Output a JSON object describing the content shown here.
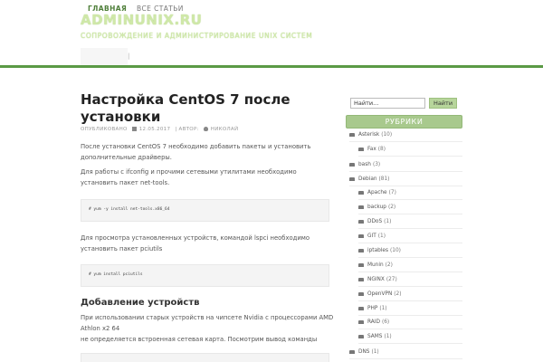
{
  "site": {
    "title": "ADMINUNIX.RU",
    "tagline": "СОПРОВОЖДЕНИЕ И АДМИНИСТРИРОВАНИЕ UNIX СИСТЕМ"
  },
  "nav": {
    "items": [
      {
        "label": "ГЛАВНАЯ"
      },
      {
        "label": "ВСЕ СТАТЬИ"
      }
    ],
    "separator": "|"
  },
  "post": {
    "title": "Настройка CentOS 7 после установки",
    "meta": {
      "published_label": "ОПУБЛИКОВАНО",
      "date": "12.05.2017",
      "author_label": "| АВТОР:",
      "author": "НИКОЛАЙ"
    },
    "p1": "После установки CentOS 7 необходимо добавить пакеты и установить дополнительные драйверы.",
    "p2": "Для работы с ifconfig и прочими сетевыми утилитами необходимо установить пакет net-tools.",
    "code1": "# yum -y install net-tools.x86_64",
    "p3": "Для просмотра установленных устройств, командой lspci необходимо установить пакет pciutils",
    "code2": "# yum install pciutils",
    "h2": "Добавление устройств",
    "p4_line1": "При использовании старых устройств на чипсете Nvidia с процессорами AMD Athlon x2 64",
    "p4_line2": "не определяется встроенная сетевая карта. Посмотрим вывод команды"
  },
  "sidebar": {
    "search_placeholder": "Найти...",
    "search_value": "Найти...",
    "search_button": "Найти",
    "widget_title": "РУБРИКИ",
    "categories": [
      {
        "name": "Asterisk",
        "count": "(10)"
      },
      {
        "name": "Fax",
        "count": "(8)"
      },
      {
        "name": "bash",
        "count": "(3)"
      },
      {
        "name": "Debian",
        "count": "(81)"
      },
      {
        "name": "Apache",
        "count": "(7)"
      },
      {
        "name": "backup",
        "count": "(2)"
      },
      {
        "name": "DDoS",
        "count": "(1)"
      },
      {
        "name": "GIT",
        "count": "(1)"
      },
      {
        "name": "iptables",
        "count": "(10)"
      },
      {
        "name": "Munin",
        "count": "(2)"
      },
      {
        "name": "NGINX",
        "count": "(27)"
      },
      {
        "name": "OpenVPN",
        "count": "(2)"
      },
      {
        "name": "PHP",
        "count": "(1)"
      },
      {
        "name": "RAID",
        "count": "(6)"
      },
      {
        "name": "SAMS",
        "count": "(1)"
      },
      {
        "name": "DNS",
        "count": "(1)"
      }
    ]
  }
}
